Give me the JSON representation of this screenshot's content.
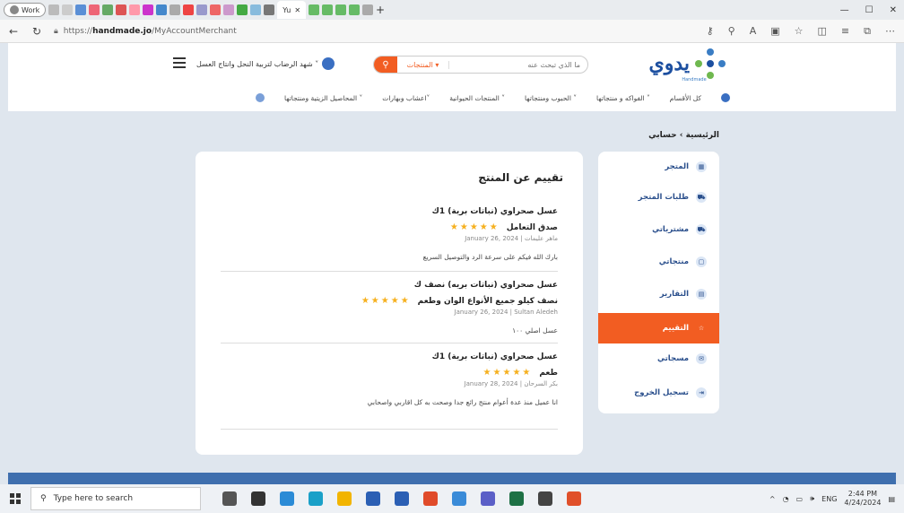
{
  "browser": {
    "profile_label": "Work",
    "active_tab_label": "Yu",
    "url_prefix": "https://",
    "url_domain": "handmade.jo",
    "url_path": "/MyAccountMerchant",
    "window_controls": [
      "—",
      "☐",
      "✕"
    ]
  },
  "header": {
    "logo_text": "يدوي",
    "logo_subtitle": "Handmade",
    "search_placeholder": "ما الذي تبحث عنه",
    "search_category": "المنتجات ▾",
    "user_name": "شهد الرضاب لتربية النحل وانتاج العسل ˅",
    "categories": [
      "كل الأقسام",
      "الفواكه و منتجاتها ˅",
      "الحبوب ومنتجاتها ˅",
      "المنتجات الحيوانية ˅",
      "اعشاب وبهارات˅",
      "المحاصيل الزيتية ومنتجاتها ˅"
    ]
  },
  "breadcrumb": "الرئيسية › حسابي",
  "sidebar": {
    "items": [
      {
        "label": "المتجر",
        "icon": "store-icon"
      },
      {
        "label": "طلبات المتجر",
        "icon": "cart-icon"
      },
      {
        "label": "مشترياتي",
        "icon": "purchases-icon"
      },
      {
        "label": "منتجاتي",
        "icon": "products-icon"
      },
      {
        "label": "التقارير",
        "icon": "reports-icon"
      },
      {
        "label": "التقييم",
        "icon": "star-icon"
      },
      {
        "label": "مسجاتي",
        "icon": "mail-icon"
      },
      {
        "label": "تسجيل الخروج",
        "icon": "logout-icon"
      }
    ],
    "active_index": 5,
    "accent_color": "#f25d22"
  },
  "reviews_panel": {
    "title": "تقييم عن المنتج",
    "reviews": [
      {
        "product": "عسل صحراوي (نباتات برية) 1ك",
        "headline": "صدق التعامل",
        "stars": "★★★★★",
        "meta": "January 26, 2024 | ماهر عليمات",
        "body": "بارك الله فيكم على سرعة الرد والتوصيل السريع"
      },
      {
        "product": "عسل صحراوي (نباتات بريه) نصف ك",
        "headline": "نصف كيلو جميع الأنواع الوان وطعم",
        "stars": "★★★★★",
        "meta": "January 26, 2024 | Sultan Aledeh",
        "body": "عسل اصلي ١٠٠"
      },
      {
        "product": "عسل صحراوي (نباتات برية) 1ك",
        "headline": "طعم",
        "stars": "★★★★★",
        "meta": "January 28, 2024 | بكر السرحان",
        "body": "انا عميل منذ عدة أعوام منتج رائع جدا وصحت به كل اقاربي واصحابي"
      }
    ]
  },
  "taskbar": {
    "search_placeholder": "Type here to search",
    "language": "ENG",
    "time": "2:44 PM",
    "date": "4/24/2024"
  }
}
